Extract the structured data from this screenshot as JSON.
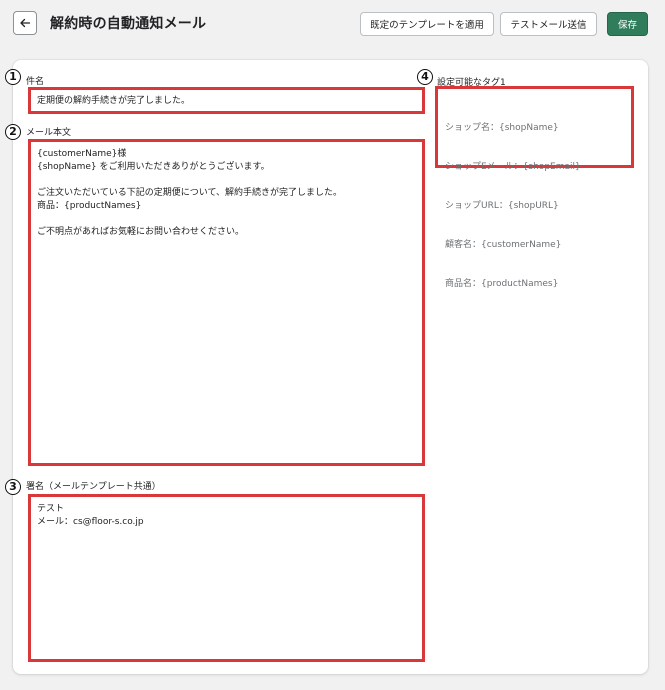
{
  "header": {
    "title": "解約時の自動通知メール",
    "apply_template_label": "既定のテンプレートを適用",
    "send_test_label": "テストメール送信",
    "save_label": "保存"
  },
  "markers": [
    "1",
    "2",
    "3",
    "4"
  ],
  "form": {
    "subject": {
      "label": "件名",
      "value": "定期便の解約手続きが完了しました。"
    },
    "body": {
      "label": "メール本文",
      "value": "{customerName}様\n{shopName} をご利用いただきありがとうございます。\n\nご注文いただいている下記の定期便について、解約手続きが完了しました。\n商品：{productNames}\n\nご不明点があればお気軽にお問い合わせください。"
    },
    "signature": {
      "label": "署名（メールテンプレート共通）",
      "value": "テスト\nメール：cs@floor-s.co.jp"
    }
  },
  "tags": {
    "label": "設定可能なタグ1",
    "items": [
      "ショップ名：{shopName}",
      "ショップEメール：{shopEmail}",
      "ショップURL：{shopURL}",
      "顧客名：{customerName}",
      "商品名：{productNames}"
    ]
  },
  "colors": {
    "highlight": "#d9383a",
    "save_button": "#2f7d5b",
    "page_background": "#f1f1f1"
  },
  "icons": {
    "back": "arrow-left-icon"
  }
}
